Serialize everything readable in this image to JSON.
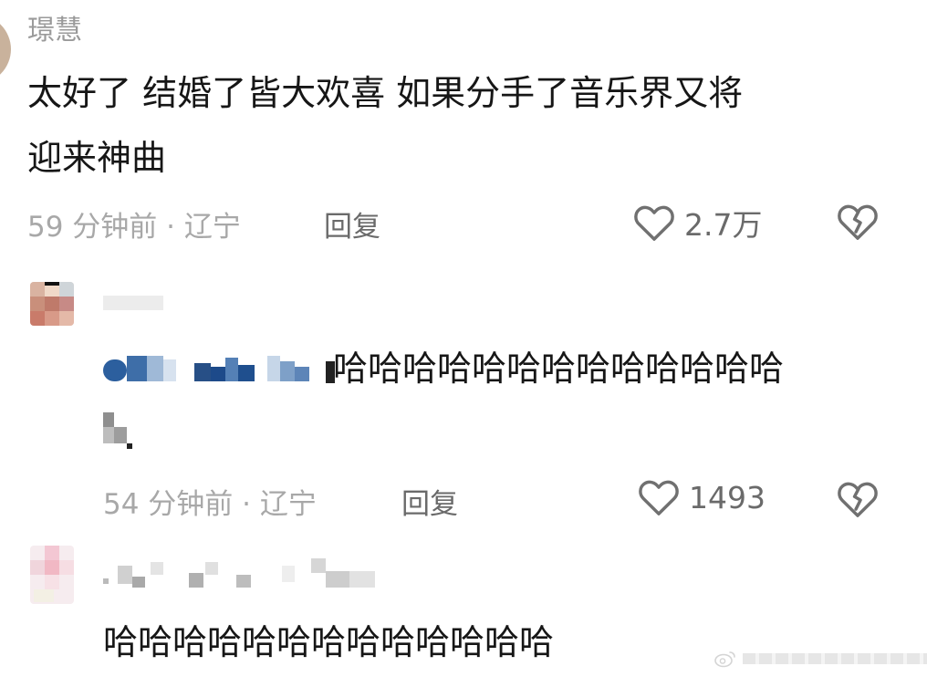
{
  "comments": [
    {
      "username": "璟慧",
      "text_line1": "太好了  结婚了皆大欢喜 如果分手了音乐界又将",
      "text_line2": "迎来神曲",
      "time_location": "59 分钟前 · 辽宁",
      "reply_label": "回复",
      "like_count": "2.7万"
    },
    {
      "username": "",
      "text": "哈哈哈哈哈哈哈哈哈哈哈哈哈",
      "time_location": "54 分钟前 · 辽宁",
      "reply_label": "回复",
      "like_count": "1493"
    },
    {
      "username": "",
      "text": "哈哈哈哈哈哈哈哈哈哈哈哈哈"
    }
  ],
  "icons": {
    "like": "heart-outline-icon",
    "dislike": "broken-heart-icon"
  },
  "colors": {
    "text": "#161616",
    "meta": "#a8a8a8",
    "action": "#6a6a6a",
    "background": "#ffffff"
  }
}
